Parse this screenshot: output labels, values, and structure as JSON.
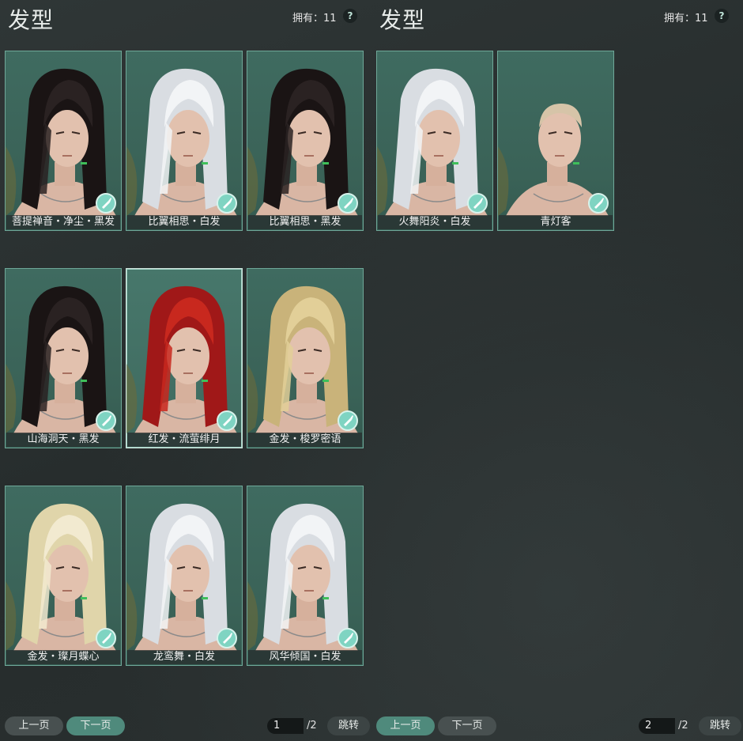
{
  "colors": {
    "accent": "#4f8a7c",
    "card_bg": "#3f6b60",
    "card_border": "#6fa899",
    "brush_badge": "#7fd4c2"
  },
  "panels": [
    {
      "title": "发型",
      "owned": "拥有：11",
      "help_icon": "?",
      "cards": [
        {
          "label": "菩提禅音・净尘・黑发",
          "hair": "black"
        },
        {
          "label": "比翼相思・白发",
          "hair": "white"
        },
        {
          "label": "比翼相思・黑发",
          "hair": "black"
        },
        {
          "label": "山海洞天・黑发",
          "hair": "black"
        },
        {
          "label": "红发・流萤绯月",
          "hair": "red",
          "selected": true
        },
        {
          "label": "金发・梭罗密语",
          "hair": "blonde"
        },
        {
          "label": "金发・璨月蝶心",
          "hair": "pale-blonde"
        },
        {
          "label": "龙鸾舞・白发",
          "hair": "white"
        },
        {
          "label": "风华倾国・白发",
          "hair": "white"
        }
      ],
      "pager": {
        "prev": "上一页",
        "next": "下一页",
        "page": "1",
        "total": "/2",
        "jump": "跳转"
      }
    },
    {
      "title": "发型",
      "owned": "拥有：11",
      "help_icon": "?",
      "cards": [
        {
          "label": "火舞阳炎・白发",
          "hair": "white"
        },
        {
          "label": "青灯客",
          "hair": "bald"
        }
      ],
      "pager": {
        "prev": "上一页",
        "next": "下一页",
        "page": "2",
        "total": "/2",
        "jump": "跳转"
      }
    }
  ]
}
